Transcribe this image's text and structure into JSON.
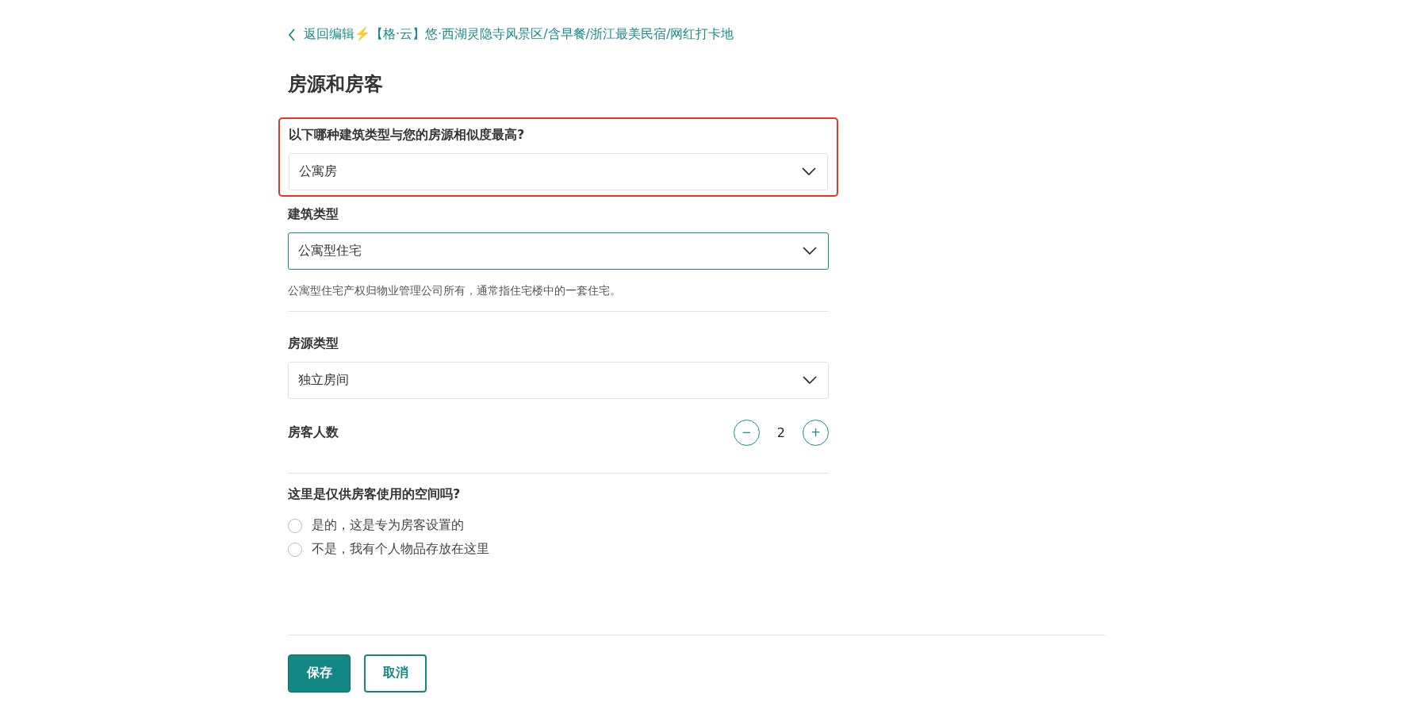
{
  "back_link": {
    "text": "返回编辑⚡️【格·云】悠·西湖灵隐寺风景区/含早餐/浙江最美民宿/网红打卡地"
  },
  "title": "房源和房客",
  "selects": [
    {
      "label": "以下哪种建筑类型与您的房源相似度最高?",
      "value": "公寓房",
      "highlighted": true,
      "focused": false
    },
    {
      "label": "建筑类型",
      "value": "公寓型住宅",
      "highlighted": false,
      "focused": true,
      "help": "公寓型住宅产权归物业管理公司所有，通常指住宅楼中的一套住宅。"
    },
    {
      "label": "房源类型",
      "value": "独立房间",
      "highlighted": false,
      "focused": false
    }
  ],
  "guests": {
    "label": "房客人数",
    "minus": "−",
    "value": "2",
    "plus": "+"
  },
  "private_space": {
    "question": "这里是仅供房客使用的空间吗?",
    "options": [
      {
        "label": "是的，这是专为房客设置的",
        "selected": false
      },
      {
        "label": "不是，我有个人物品存放在这里",
        "selected": false
      }
    ]
  },
  "buttons": {
    "save": "保存",
    "cancel": "取消"
  }
}
